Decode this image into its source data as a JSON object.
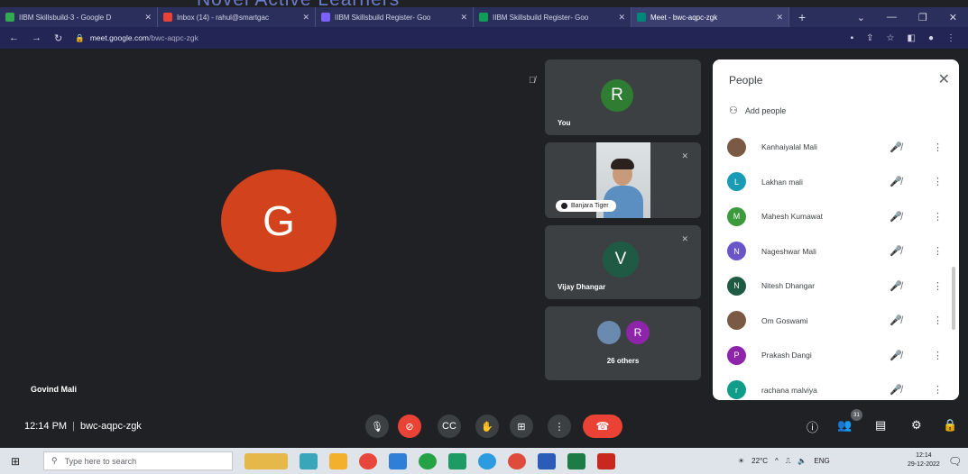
{
  "banner": {
    "text": "Novel Active Learners"
  },
  "browser": {
    "tabs": [
      {
        "title": "IIBM Skillsbuild-3 - Google D",
        "color": "#34a853"
      },
      {
        "title": "Inbox (14) - rahul@smartgac",
        "color": "#ea4335"
      },
      {
        "title": "IIBM Skillsbuild Register- Goo",
        "color": "#7b61ff"
      },
      {
        "title": "IIBM Skillsbuild Register- Goo",
        "color": "#0f9d58"
      },
      {
        "title": "Meet - bwc-aqpc-zgk",
        "color": "#00897b"
      }
    ],
    "new_tab": "+",
    "url_host": "meet.google.com",
    "url_path": "/bwc-aqpc-zgk"
  },
  "meet": {
    "main": {
      "initial": "G",
      "name": "Govind Mali",
      "color": "#d2421c"
    },
    "tiles": [
      {
        "initial": "R",
        "name": "You",
        "color": "#2f7d32"
      },
      {
        "name": "Banjara Tiger",
        "video": true
      },
      {
        "initial": "V",
        "name": "Vijay Dhangar",
        "color": "#1e5a44"
      },
      {
        "initial": "R",
        "name": "26 others",
        "color": "#8e24aa"
      }
    ]
  },
  "panel": {
    "title": "People",
    "add_people": "Add people",
    "participants": [
      {
        "initial": "",
        "name": "Kanhaiyalal Mali",
        "color": "#7a5a44",
        "photo": true
      },
      {
        "initial": "L",
        "name": "Lakhan mali",
        "color": "#1a9bb5"
      },
      {
        "initial": "M",
        "name": "Mahesh Kumawat",
        "color": "#3c9a3c"
      },
      {
        "initial": "N",
        "name": "Nageshwar Mali",
        "color": "#6a55c8"
      },
      {
        "initial": "N",
        "name": "Nitesh Dhangar",
        "color": "#1e5a44"
      },
      {
        "initial": "",
        "name": "Om Goswami",
        "color": "#7a5a44",
        "photo": true
      },
      {
        "initial": "P",
        "name": "Prakash Dangi",
        "color": "#8e24aa"
      },
      {
        "initial": "r",
        "name": "rachana malviya",
        "color": "#0f9d8a"
      }
    ]
  },
  "controls": {
    "time": "12:14 PM",
    "meeting_code": "bwc-aqpc-zgk",
    "people_count": "31"
  },
  "taskbar": {
    "search_placeholder": "Type here to search",
    "temperature": "22°C",
    "language": "ENG",
    "time": "12:14",
    "date": "29-12-2022"
  }
}
